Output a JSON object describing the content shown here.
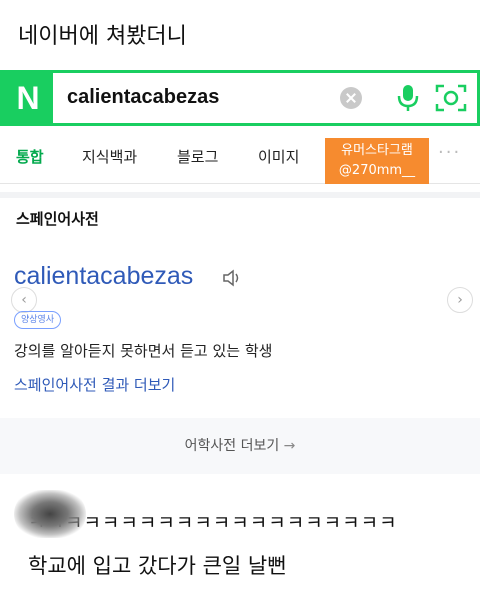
{
  "caption_top": "네이버에 쳐봤더니",
  "search": {
    "logo": "N",
    "query": "calientacabezas"
  },
  "tabs": [
    {
      "label": "통합",
      "active": true
    },
    {
      "label": "지식백과"
    },
    {
      "label": "블로그"
    },
    {
      "label": "이미지"
    }
  ],
  "tabs_more": "···",
  "watermark": {
    "line1": "유머스타그램",
    "line2": "@270mm__"
  },
  "dictionary": {
    "section_title": "스페인어사전",
    "word": "calientacabezas",
    "badge": "양상영사",
    "meaning": "강의를 알아듣지 못하면서 듣고 있는 학생",
    "more_link": "스페인어사전 결과 더보기"
  },
  "dict_more": {
    "label": "어학사전 더보기",
    "arrow": "→"
  },
  "laugh_text": "ㅋㅋㅋㅋㅋㅋㅋㅋㅋㅋㅋㅋㅋㅋㅋㅋㅋㅋㅋㅋ",
  "caption_bottom": "학교에 입고 갔다가 큰일 날뻔",
  "colors": {
    "naver_green": "#19ce60",
    "link_blue": "#2f5ab8",
    "watermark_orange": "#f68b2f"
  },
  "icons": [
    "clear-icon",
    "mic-icon",
    "lens-icon",
    "speaker-icon",
    "chevron-left-icon",
    "chevron-right-icon"
  ]
}
